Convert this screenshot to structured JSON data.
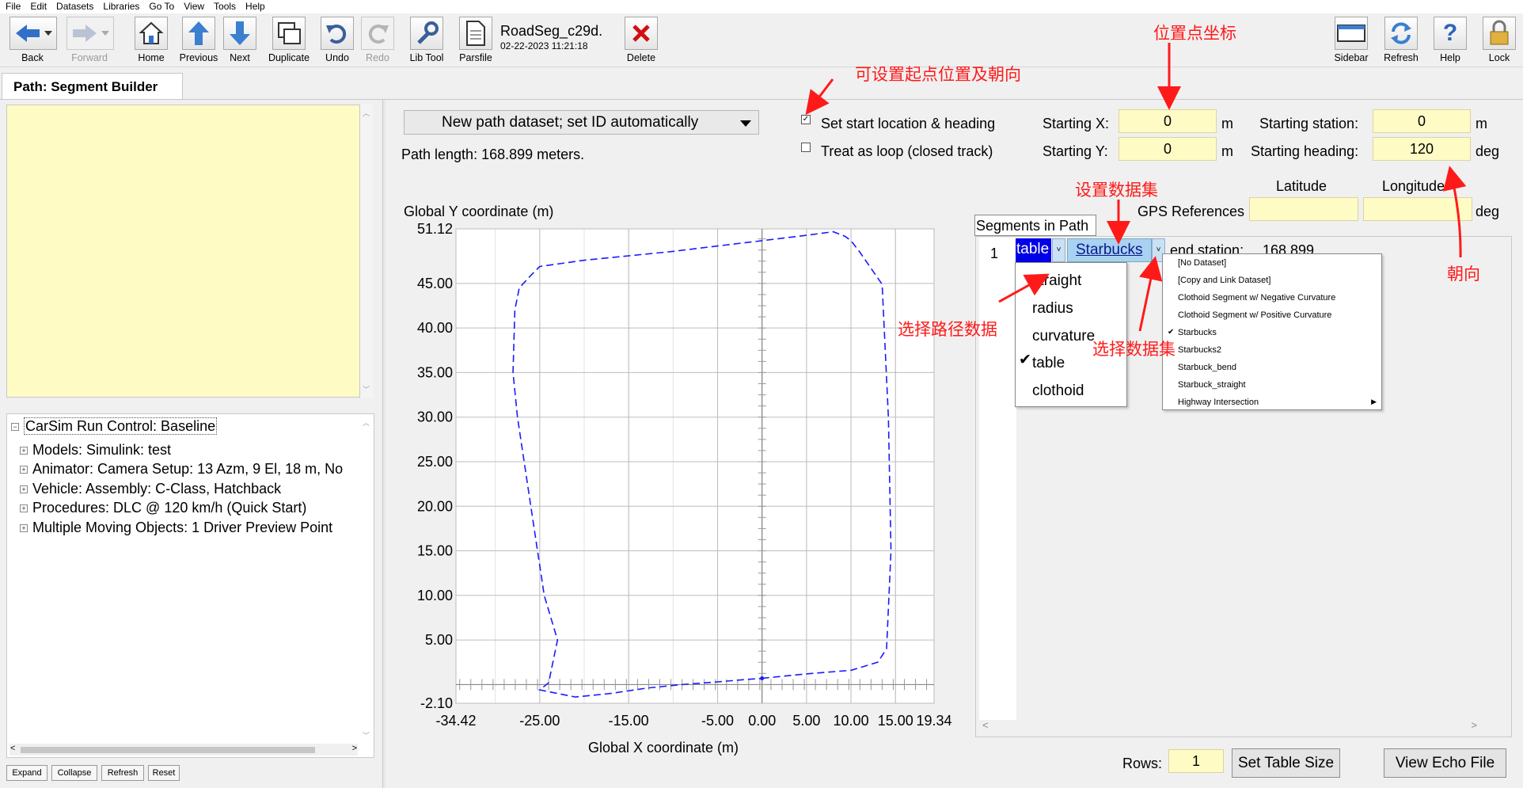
{
  "menu": [
    "File",
    "Edit",
    "Datasets",
    "Libraries",
    "Go To",
    "View",
    "Tools",
    "Help"
  ],
  "toolbar": {
    "back": "Back",
    "forward": "Forward",
    "home": "Home",
    "previous": "Previous",
    "next": "Next",
    "duplicate": "Duplicate",
    "undo": "Undo",
    "redo": "Redo",
    "lib_tool": "Lib Tool",
    "parsfile": "Parsfile",
    "delete": "Delete",
    "sidebar": "Sidebar",
    "refresh": "Refresh",
    "help": "Help",
    "lock": "Lock",
    "doc_name": "RoadSeg_c29d.",
    "doc_date": "02-22-2023 11:21:18"
  },
  "tab_title": "Path: Segment Builder",
  "tree": {
    "root": "CarSim Run Control: Baseline",
    "items": [
      "Models: Simulink: test",
      "Animator: Camera Setup: 13 Azm, 9 El, 18 m, No",
      "Vehicle: Assembly: C-Class, Hatchback",
      "Procedures: DLC @ 120 km/h (Quick Start)",
      "Multiple Moving Objects: 1 Driver Preview Point"
    ]
  },
  "left_buttons": {
    "expand": "Expand",
    "collapse": "Collapse",
    "refresh": "Refresh",
    "reset": "Reset"
  },
  "main": {
    "dataset_dropdown": "New path dataset; set ID automatically",
    "path_length": "Path length: 168.899 meters.",
    "set_start_label": "Set start location & heading",
    "set_start_checked": true,
    "loop_label": "Treat as loop (closed track)",
    "loop_checked": false,
    "start_x_label": "Starting X:",
    "start_x": "0",
    "unit_m": "m",
    "start_y_label": "Starting Y:",
    "start_y": "0",
    "start_station_label": "Starting station:",
    "start_station": "0",
    "start_heading_label": "Starting heading:",
    "start_heading": "120",
    "unit_deg": "deg",
    "latitude_label": "Latitude",
    "longitude_label": "Longitude",
    "gps_label": "GPS References",
    "gps_unit": "deg"
  },
  "segments": {
    "header": "Segments in Path",
    "row_num": "1",
    "type": "table",
    "dataset": "Starbucks",
    "end_station_label": "end station:",
    "end_station": "168.899",
    "type_options": [
      "straight",
      "radius",
      "curvature",
      "table",
      "clothoid"
    ],
    "type_selected": "table",
    "dataset_options": [
      "[No Dataset]",
      "[Copy and Link Dataset]",
      "Clothoid Segment w/ Negative Curvature",
      "Clothoid Segment w/ Positive Curvature",
      "Starbucks",
      "Starbucks2",
      "Starbuck_bend",
      "Starbuck_straight",
      "Highway Intersection"
    ],
    "dataset_selected": "Starbucks",
    "rows_label": "Rows:",
    "rows": "1",
    "set_table_size": "Set Table Size",
    "view_echo": "View Echo File"
  },
  "annotations": {
    "start_pos": "可设置起点位置及朝向",
    "coord": "位置点坐标",
    "set_dataset": "设置数据集",
    "select_path": "选择路径数据",
    "select_dataset": "选择数据集",
    "heading": "朝向"
  },
  "colors": {
    "accent_red": "#ff1a1a",
    "input_yellow": "#fffbc5",
    "path_blue": "#1a1aff",
    "select_blue": "#0000e6"
  },
  "chart_data": {
    "type": "line",
    "ylabel": "Global Y coordinate (m)",
    "xlabel": "Global X coordinate (m)",
    "xlim": [
      -34.42,
      19.34
    ],
    "ylim": [
      -2.1,
      51.12
    ],
    "x_ticks": [
      -34.42,
      -25.0,
      -15.0,
      -5.0,
      0.0,
      5.0,
      10.0,
      15.0,
      19.34
    ],
    "x_tick_labels": [
      "-34.42",
      "-25.00",
      "-15.00",
      "-5.00",
      "0.00",
      "5.00",
      "10.00",
      "15.00",
      "19.34"
    ],
    "y_ticks": [
      -2.1,
      5.0,
      10.0,
      15.0,
      20.0,
      25.0,
      30.0,
      35.0,
      40.0,
      45.0,
      51.12
    ],
    "y_tick_labels": [
      "-2.10",
      "5.00",
      "10.00",
      "15.00",
      "20.00",
      "25.00",
      "30.00",
      "35.00",
      "40.00",
      "45.00",
      "51.12"
    ],
    "grid": true,
    "series": [
      {
        "style": "dashed",
        "color": "#1a1aff",
        "x": [
          0,
          5,
          10,
          13,
          14,
          14.5,
          14.2,
          13.5,
          11,
          10,
          9.3,
          8,
          5,
          0,
          -5,
          -10,
          -15,
          -20,
          -25,
          -26,
          -27.3,
          -27.8,
          -28,
          -27.5,
          -26,
          -24.5,
          -23,
          -24,
          -25,
          -21,
          -17,
          -13,
          -9,
          -5,
          -2,
          0
        ],
        "y": [
          0.7,
          1.2,
          1.6,
          2.5,
          4,
          15,
          30,
          44.9,
          48.5,
          49.8,
          50.3,
          50.8,
          50.4,
          49.8,
          49.2,
          48.6,
          48.1,
          47.6,
          46.9,
          45.9,
          44.5,
          42,
          35,
          30,
          20,
          10,
          5,
          0.2,
          -0.6,
          -1.4,
          -1,
          -0.4,
          0,
          0.3,
          0.55,
          0.7
        ]
      }
    ]
  }
}
